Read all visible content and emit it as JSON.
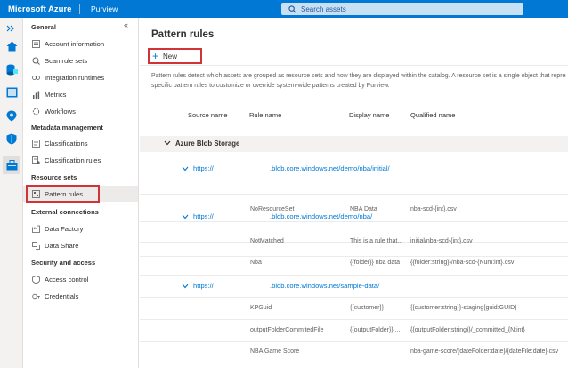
{
  "header": {
    "brand": "Microsoft Azure",
    "product": "Purview",
    "search_placeholder": "Search assets"
  },
  "icon_rail": [
    {
      "icon": "home-icon"
    },
    {
      "icon": "data-source-icon"
    },
    {
      "icon": "glossary-icon"
    },
    {
      "icon": "insights-icon"
    },
    {
      "icon": "shield-icon"
    },
    {
      "icon": "management-icon"
    }
  ],
  "sidebar": {
    "collapse": "«",
    "sections": [
      {
        "title": "General",
        "items": [
          "Account information",
          "Scan rule sets",
          "Integration runtimes",
          "Metrics",
          "Workflows"
        ]
      },
      {
        "title": "Metadata management",
        "items": [
          "Classifications",
          "Classification rules"
        ]
      },
      {
        "title": "Resource sets",
        "items": [
          "Pattern rules"
        ]
      },
      {
        "title": "External connections",
        "items": [
          "Data Factory",
          "Data Share"
        ]
      },
      {
        "title": "Security and access",
        "items": [
          "Access control",
          "Credentials"
        ]
      }
    ]
  },
  "main": {
    "title": "Pattern rules",
    "new_label": "New",
    "description_line1": "Pattern rules detect which assets are grouped as resource sets and how they are displayed within the catalog. A resource set is a single object that represe",
    "description_line2": "specific pattern rules to customize or override system-wide patterns created by Purview.",
    "columns": [
      "Source name",
      "Rule name",
      "Display name",
      "Qualified name"
    ],
    "group": "Azure Blob Storage",
    "sources": [
      {
        "prefix": "https://",
        "path": ".blob.core.windows.net/demo/nba/initial/",
        "rules": [
          {
            "rule": "NoResourceSet",
            "display": "NBA Data",
            "qualified": "nba-scd-{int}.csv"
          }
        ]
      },
      {
        "prefix": "https://",
        "path": ".blob.core.windows.net/demo/nba/",
        "rules": [
          {
            "rule": "NotMatched",
            "display": "This is a rule that...",
            "qualified": "initial/nba-scd-{int}.csv"
          },
          {
            "rule": "Nba",
            "display": "{{folder}} nba data",
            "qualified": "{{folder:string}}/nba-scd-{Num:int}.csv"
          }
        ]
      },
      {
        "prefix": "https://",
        "path": ".blob.core.windows.net/sample-data/",
        "rules": [
          {
            "rule": "KPGuid",
            "display": "{{customer}}",
            "qualified": "{{customer:string}}-staging{guid:GUID}"
          },
          {
            "rule": "outputFolderCommitedFile",
            "display": "{{outputFolder}} ...",
            "qualified": "{{outputFolder:string}}/_committed_{N:int}"
          },
          {
            "rule": "NBA Game Score",
            "display": "",
            "qualified": "nba-game-score/{dateFolder:date}/{dateFile:date}.csv"
          }
        ]
      }
    ]
  },
  "colors": {
    "accent": "#0078d4",
    "highlight": "#d13438"
  }
}
